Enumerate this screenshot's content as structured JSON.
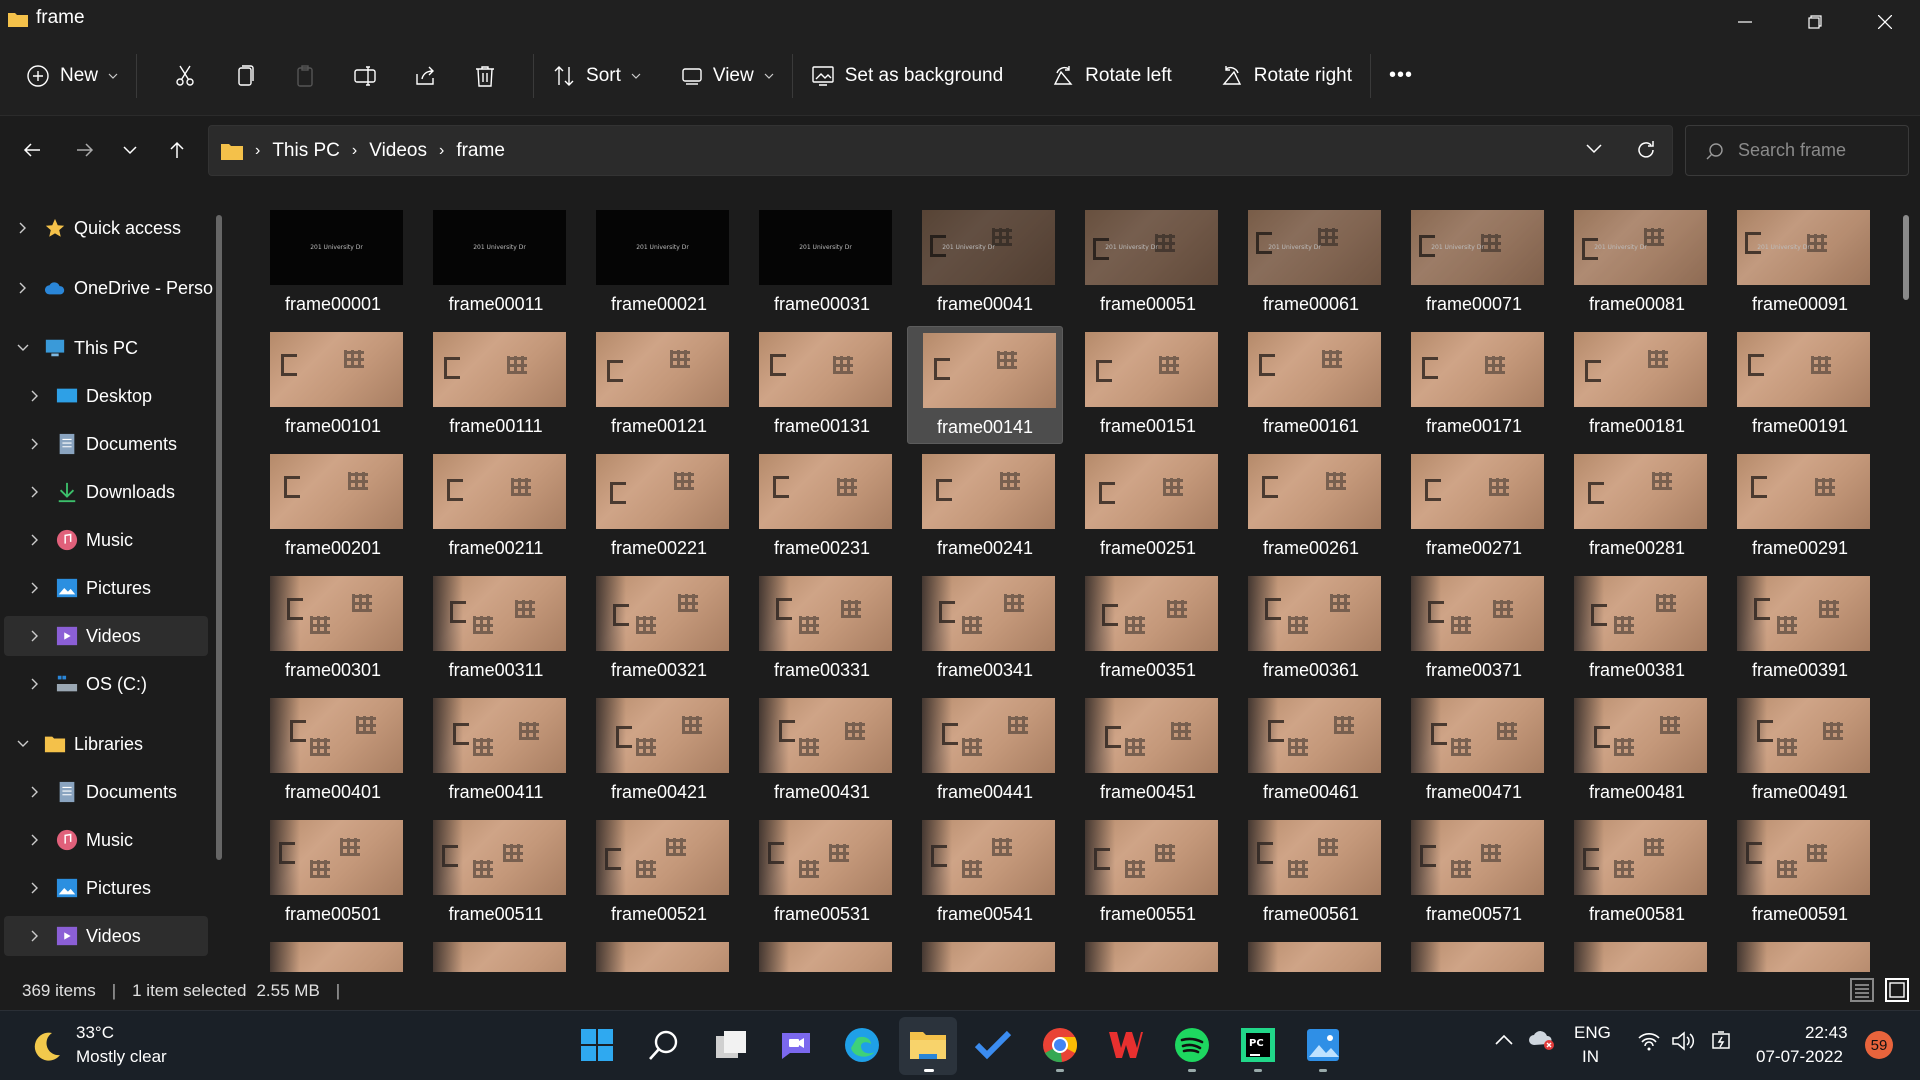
{
  "window": {
    "title": "frame"
  },
  "commandbar": {
    "new_label": "New",
    "sort_label": "Sort",
    "view_label": "View",
    "set_background_label": "Set as background",
    "rotate_left_label": "Rotate left",
    "rotate_right_label": "Rotate right",
    "more_label": "•••"
  },
  "address": {
    "crumbs": [
      "This PC",
      "Videos",
      "frame"
    ],
    "search_placeholder": "Search frame"
  },
  "sidebar": {
    "items": [
      {
        "label": "Quick access",
        "icon": "star-icon"
      },
      {
        "label": "OneDrive - Perso",
        "icon": "cloud-icon"
      },
      {
        "label": "This PC",
        "icon": "computer-icon"
      },
      {
        "label": "Desktop",
        "icon": "desktop-icon"
      },
      {
        "label": "Documents",
        "icon": "documents-icon"
      },
      {
        "label": "Downloads",
        "icon": "download-icon"
      },
      {
        "label": "Music",
        "icon": "music-icon"
      },
      {
        "label": "Pictures",
        "icon": "pictures-icon"
      },
      {
        "label": "Videos",
        "icon": "videos-icon"
      },
      {
        "label": "OS (C:)",
        "icon": "drive-icon"
      },
      {
        "label": "Libraries",
        "icon": "folder-icon"
      },
      {
        "label": "Documents",
        "icon": "documents-icon"
      },
      {
        "label": "Music",
        "icon": "music-icon"
      },
      {
        "label": "Pictures",
        "icon": "pictures-icon"
      },
      {
        "label": "Videos",
        "icon": "videos-icon"
      }
    ]
  },
  "files": [
    "frame00001",
    "frame00011",
    "frame00021",
    "frame00031",
    "frame00041",
    "frame00051",
    "frame00061",
    "frame00071",
    "frame00081",
    "frame00091",
    "frame00101",
    "frame00111",
    "frame00121",
    "frame00131",
    "frame00141",
    "frame00151",
    "frame00161",
    "frame00171",
    "frame00181",
    "frame00191",
    "frame00201",
    "frame00211",
    "frame00221",
    "frame00231",
    "frame00241",
    "frame00251",
    "frame00261",
    "frame00271",
    "frame00281",
    "frame00291",
    "frame00301",
    "frame00311",
    "frame00321",
    "frame00331",
    "frame00341",
    "frame00351",
    "frame00361",
    "frame00371",
    "frame00381",
    "frame00391",
    "frame00401",
    "frame00411",
    "frame00421",
    "frame00431",
    "frame00441",
    "frame00451",
    "frame00461",
    "frame00471",
    "frame00481",
    "frame00491",
    "frame00501",
    "frame00511",
    "frame00521",
    "frame00531",
    "frame00541",
    "frame00551",
    "frame00561",
    "frame00571",
    "frame00581",
    "frame00591"
  ],
  "thumbnail_caption": "201 University Dr",
  "selected_file": "frame00141",
  "status": {
    "item_count": "369 items",
    "selection": "1 item selected",
    "size": "2.55 MB"
  },
  "taskbar": {
    "temperature": "33°C",
    "weather": "Mostly clear",
    "lang": "ENG",
    "region": "IN",
    "time": "22:43",
    "date": "07-07-2022",
    "notification_count": "59"
  },
  "colors": {
    "accent": "#0078d4",
    "folder": "#f4c14a",
    "background": "#1c1c1c"
  }
}
